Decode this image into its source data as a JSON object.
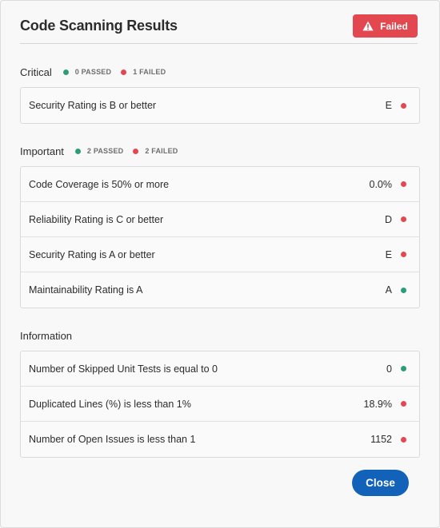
{
  "header": {
    "title": "Code Scanning Results",
    "status_label": "Failed",
    "status_color": "#e34850"
  },
  "sections": [
    {
      "title": "Critical",
      "passed_label": "0 PASSED",
      "failed_label": "1 FAILED",
      "rows": [
        {
          "label": "Security Rating is B or better",
          "value": "E",
          "status": "failed"
        }
      ]
    },
    {
      "title": "Important",
      "passed_label": "2 PASSED",
      "failed_label": "2 FAILED",
      "rows": [
        {
          "label": "Code Coverage is 50% or more",
          "value": "0.0%",
          "status": "failed"
        },
        {
          "label": "Reliability Rating is C or better",
          "value": "D",
          "status": "failed"
        },
        {
          "label": "Security Rating is A or better",
          "value": "E",
          "status": "failed"
        },
        {
          "label": "Maintainability Rating is A",
          "value": "A",
          "status": "passed"
        }
      ]
    },
    {
      "title": "Information",
      "rows": [
        {
          "label": "Number of Skipped Unit Tests is equal to 0",
          "value": "0",
          "status": "passed"
        },
        {
          "label": "Duplicated Lines (%) is less than 1%",
          "value": "18.9%",
          "status": "failed"
        },
        {
          "label": "Number of Open Issues is less than 1",
          "value": "1152",
          "status": "failed"
        }
      ]
    }
  ],
  "footer": {
    "close_label": "Close"
  },
  "colors": {
    "passed": "#2d9d78",
    "failed": "#e34850",
    "primary": "#1262b9"
  },
  "icons": {
    "status_badge": "alert-triangle-icon",
    "passed": "green-dot",
    "failed": "red-dot"
  }
}
